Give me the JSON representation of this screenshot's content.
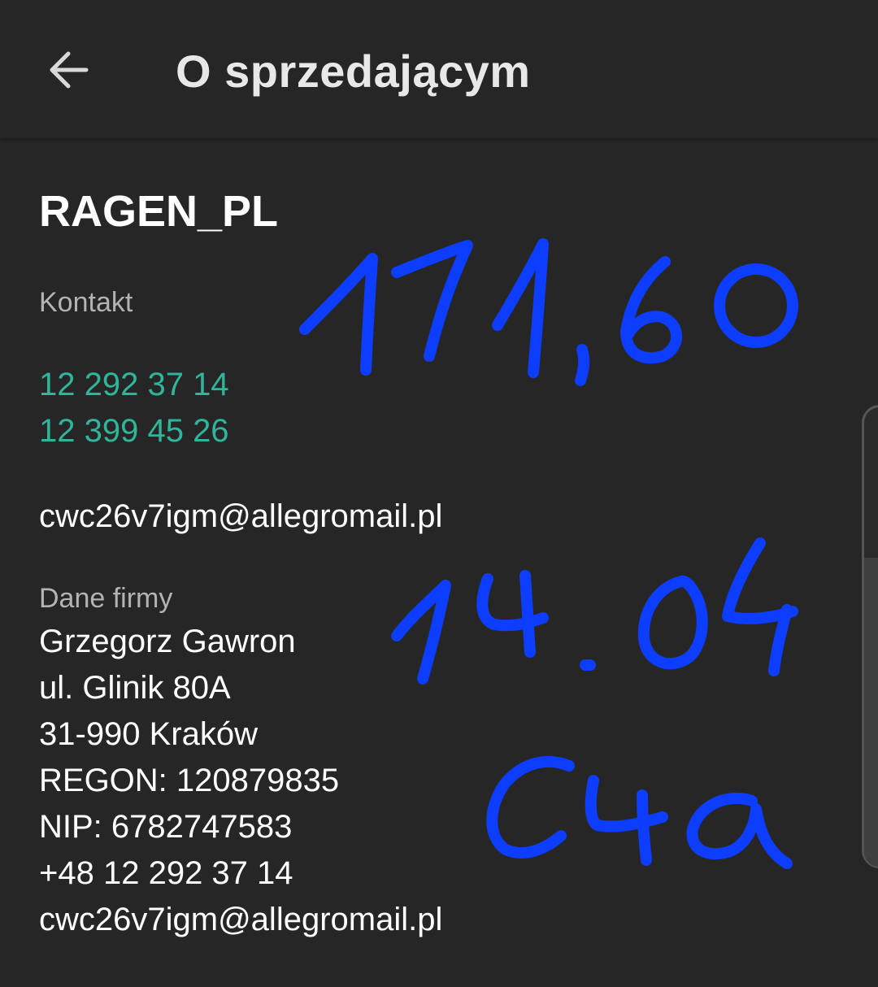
{
  "appbar": {
    "title": "O sprzedającym",
    "back_icon": "arrow-left-icon"
  },
  "seller": {
    "name": "RAGEN_PL"
  },
  "contact": {
    "label": "Kontakt",
    "phones": [
      "12 292 37 14",
      "12 399 45 26"
    ],
    "email": "cwc26v7igm@allegromail.pl"
  },
  "company": {
    "label": "Dane firmy",
    "lines": [
      "Grzegorz Gawron",
      "ul. Glinik 80A",
      "31-990 Kraków",
      "REGON: 120879835",
      "NIP: 6782747583",
      "+48 12 292 37 14",
      "cwc26v7igm@allegromail.pl"
    ]
  },
  "handwritten_annotations": [
    "171,60",
    "14.04",
    "C4a"
  ],
  "colors": {
    "background": "#262626",
    "link_phone": "#2fb59a",
    "label": "#b3b3b3",
    "annotation_ink": "#0d3dff"
  }
}
